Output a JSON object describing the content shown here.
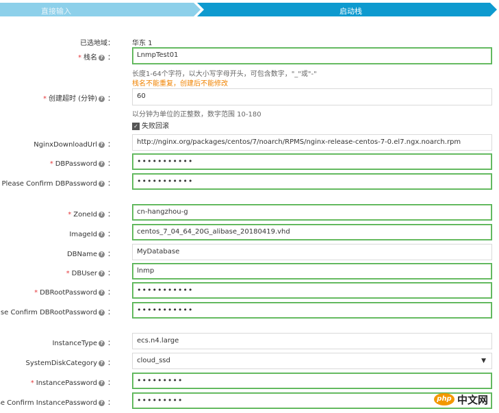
{
  "steps": {
    "step1": "直接输入",
    "step2": "启动栈"
  },
  "colors": {
    "step_active": "#0e9acf",
    "step_inactive": "#8dd0ea",
    "valid_border": "#4caf50",
    "warn": "#f08300"
  },
  "region": {
    "label": "已选地域：",
    "value": "华东 1"
  },
  "stack_name": {
    "label": "栈名",
    "value": "LnmpTest01",
    "hint1": "长度1-64个字符，以大小写字母开头，可包含数字，\"_\"或\"-\"",
    "hint2": "栈名不能重复，创建后不能修改"
  },
  "timeout": {
    "label": "创建超时 (分钟)",
    "value": "60",
    "hint": "以分钟为单位的正整数，数字范围 10-180",
    "rollback": "失败回滚"
  },
  "nginx_url": {
    "label": "NginxDownloadUrl",
    "value": "http://nginx.org/packages/centos/7/noarch/RPMS/nginx-release-centos-7-0.el7.ngx.noarch.rpm"
  },
  "db_password": {
    "label": "DBPassword",
    "value": "•••••••••••"
  },
  "db_password_confirm": {
    "label": "Please Confirm DBPassword",
    "value": "•••••••••••"
  },
  "zone_id": {
    "label": "ZoneId",
    "value": "cn-hangzhou-g"
  },
  "image_id": {
    "label": "ImageId",
    "value": "centos_7_04_64_20G_alibase_20180419.vhd"
  },
  "db_name": {
    "label": "DBName",
    "value": "MyDatabase"
  },
  "db_user": {
    "label": "DBUser",
    "value": "lnmp"
  },
  "db_root_password": {
    "label": "DBRootPassword",
    "value": "•••••••••••"
  },
  "db_root_password_confirm": {
    "label": "Please Confirm DBRootPassword",
    "value": "•••••••••••"
  },
  "instance_type": {
    "label": "InstanceType",
    "value": "ecs.n4.large"
  },
  "system_disk": {
    "label": "SystemDiskCategory",
    "value": "cloud_ssd"
  },
  "instance_password": {
    "label": "InstancePassword",
    "value": "•••••••••"
  },
  "instance_password_confirm": {
    "label": "Please Confirm InstancePassword",
    "value": "•••••••••"
  },
  "common": {
    "help": "?",
    "colon": "：",
    "required": "*",
    "caret": "▼",
    "check": "✓"
  },
  "watermark": {
    "badge": "php",
    "text": "中文网"
  }
}
